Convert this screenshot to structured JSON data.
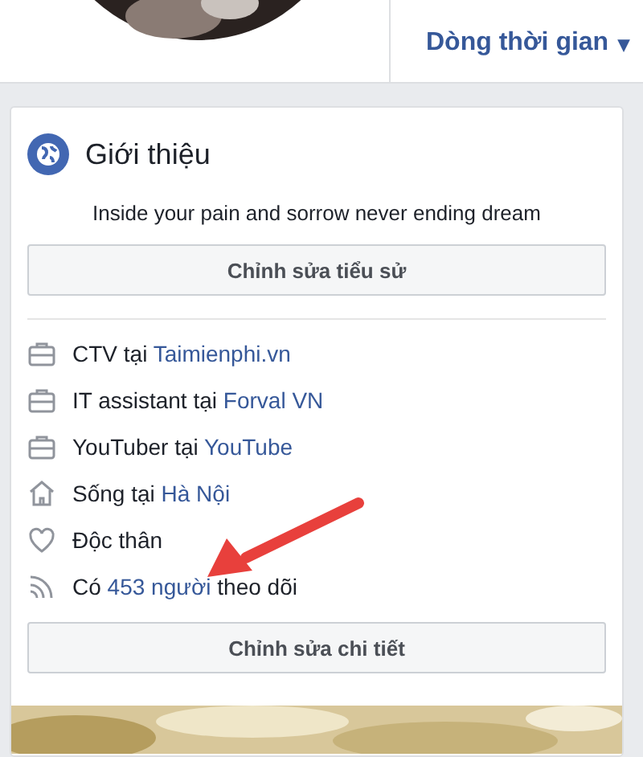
{
  "header": {
    "timeline_button": "Dòng thời gian",
    "caret": "▾"
  },
  "intro": {
    "title": "Giới thiệu",
    "bio": "Inside your pain and sorrow never ending dream",
    "edit_bio_button": "Chỉnh sửa tiểu sử",
    "items": [
      {
        "kind": "work",
        "text": "CTV tại ",
        "link": "Taimienphi.vn"
      },
      {
        "kind": "work",
        "text": "IT assistant tại ",
        "link": "Forval VN"
      },
      {
        "kind": "work",
        "text": "YouTuber tại ",
        "link": "YouTube"
      },
      {
        "kind": "home",
        "text": "Sống tại ",
        "link": "Hà Nội"
      },
      {
        "kind": "heart",
        "text": "Độc thân"
      },
      {
        "kind": "followers",
        "text": "Có ",
        "link": "453 người",
        "suffix": " theo dõi"
      }
    ],
    "edit_details_button": "Chỉnh sửa chi tiết"
  }
}
